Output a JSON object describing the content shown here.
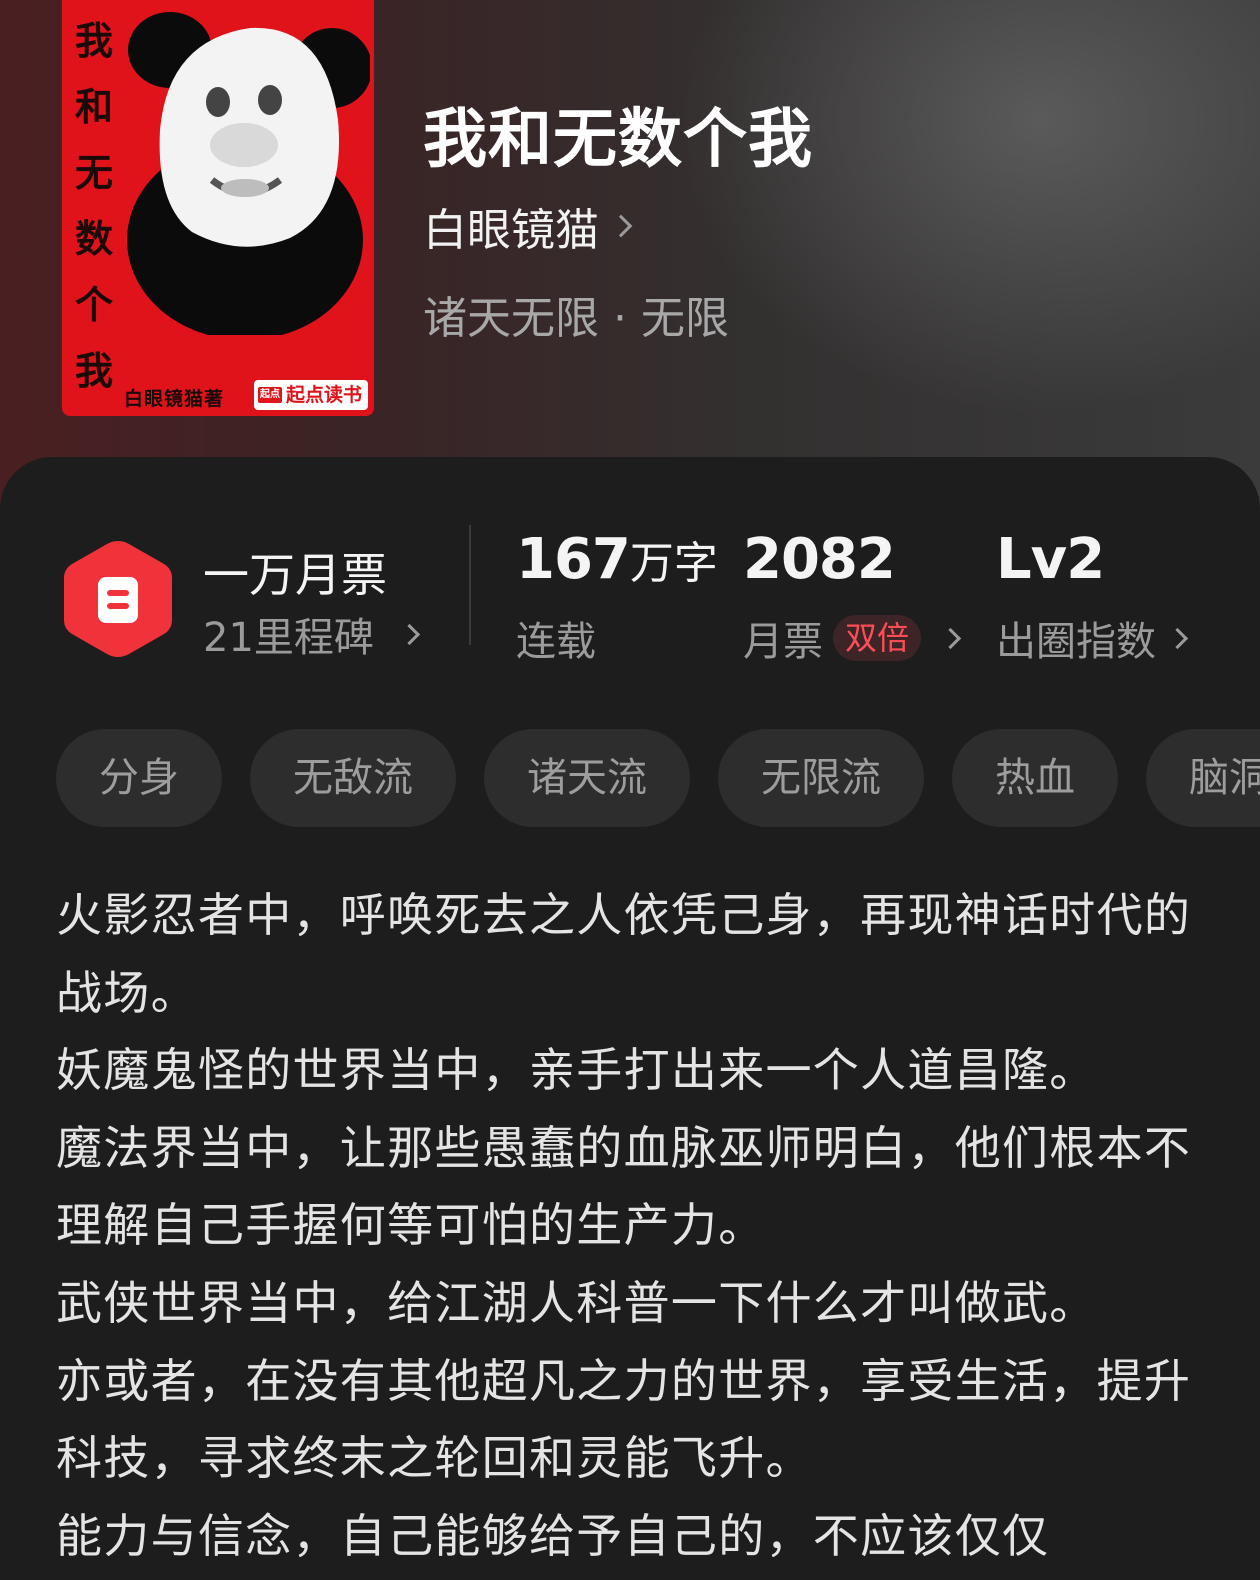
{
  "book": {
    "cover": {
      "vertical_title": [
        "我",
        "和",
        "无",
        "数",
        "个",
        "我"
      ],
      "author_credit": "白眼镜猫著",
      "publisher_badge": "起点读书",
      "publisher_mini": "起点",
      "background_color": "#e0131a"
    },
    "title": "我和无数个我",
    "author": "白眼镜猫",
    "genre": "诸天无限 · 无限"
  },
  "stats": {
    "milestone": {
      "title": "一万月票",
      "subtitle": "21里程碑",
      "icon": "ticket-hexagon-icon"
    },
    "words": {
      "number": "167",
      "unit": "万字",
      "label": "连载"
    },
    "monthly_tickets": {
      "number": "2082",
      "label": "月票",
      "tag": "双倍"
    },
    "influence": {
      "number": "Lv2",
      "label": "出圈指数"
    }
  },
  "tags": [
    "分身",
    "无敌流",
    "诸天流",
    "无限流",
    "热血",
    "脑洞"
  ],
  "description": [
    "火影忍者中，呼唤死去之人依凭己身，再现神话时代的战场。",
    "妖魔鬼怪的世界当中，亲手打出来一个人道昌隆。",
    "魔法界当中，让那些愚蠢的血脉巫师明白，他们根本不理解自己手握何等可怕的生产力。",
    "武侠世界当中，给江湖人科普一下什么才叫做武。",
    "亦或者，在没有其他超凡之力的世界，享受生活，提升科技，寻求终末之轮回和灵能飞升。",
    "能力与信念，自己能够给予自己的，不应该仅仅"
  ],
  "colors": {
    "accent_red": "#f0333a",
    "double_tag_text": "#ff4d57"
  }
}
